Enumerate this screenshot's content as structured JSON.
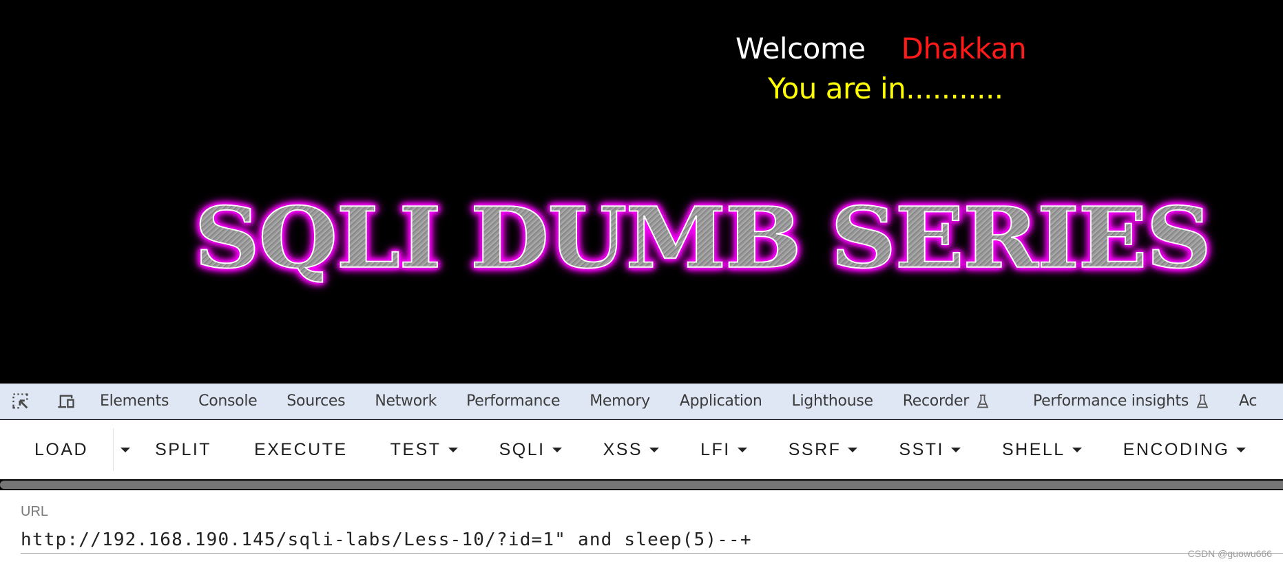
{
  "page": {
    "welcome_text": "Welcome",
    "user_name": "Dhakkan",
    "status_text": "You are in...........",
    "logo_text": "SQLI DUMB SERIES",
    "colors": {
      "background": "#000000",
      "welcome": "#ffffff",
      "user_name": "#ff1a1a",
      "status": "#ffff00",
      "logo_glow": "#ff00ff"
    }
  },
  "devtools": {
    "icons": [
      "inspect-element-icon",
      "device-toolbar-icon"
    ],
    "tabs": [
      {
        "label": "Elements"
      },
      {
        "label": "Console"
      },
      {
        "label": "Sources"
      },
      {
        "label": "Network"
      },
      {
        "label": "Performance"
      },
      {
        "label": "Memory"
      },
      {
        "label": "Application"
      },
      {
        "label": "Lighthouse"
      },
      {
        "label": "Recorder",
        "experimental": true
      },
      {
        "label": "Performance insights",
        "experimental": true
      },
      {
        "label": "Ac"
      }
    ]
  },
  "hackbar": {
    "buttons": [
      {
        "label": "LOAD",
        "dropdown": false
      },
      {
        "label": "SPLIT",
        "dropdown": false
      },
      {
        "label": "EXECUTE",
        "dropdown": false
      },
      {
        "label": "TEST",
        "dropdown": true
      },
      {
        "label": "SQLI",
        "dropdown": true
      },
      {
        "label": "XSS",
        "dropdown": true
      },
      {
        "label": "LFI",
        "dropdown": true
      },
      {
        "label": "SSRF",
        "dropdown": true
      },
      {
        "label": "SSTI",
        "dropdown": true
      },
      {
        "label": "SHELL",
        "dropdown": true
      },
      {
        "label": "ENCODING",
        "dropdown": true
      }
    ],
    "url_label": "URL",
    "url_value": "http://192.168.190.145/sqli-labs/Less-10/?id=1\" and sleep(5)--+"
  },
  "watermark": "CSDN @guowu666"
}
